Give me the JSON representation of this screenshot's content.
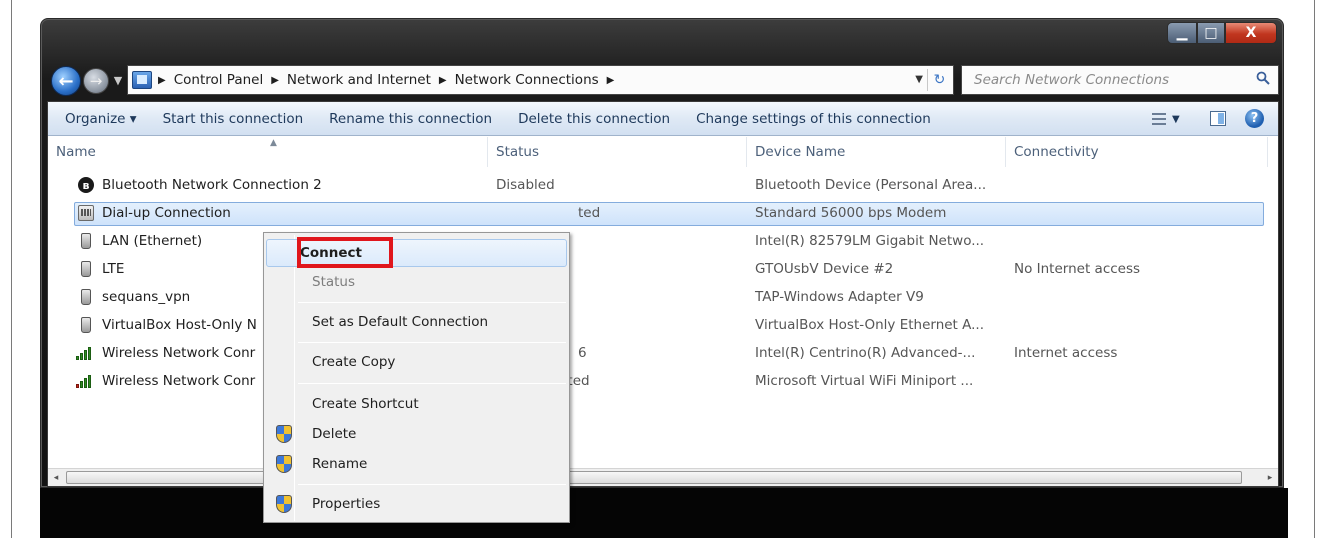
{
  "window": {
    "caption": {
      "minimize": "▁",
      "maximize": "□",
      "close": "X"
    }
  },
  "address_bar": {
    "crumbs": [
      "Control Panel",
      "Network and Internet",
      "Network Connections"
    ],
    "separator": "▶",
    "trailing_separator": "▶",
    "dropdown_glyph": "▼",
    "refresh_glyph": "↻"
  },
  "search": {
    "placeholder": "Search Network Connections"
  },
  "toolbar": {
    "organize": "Organize ▾",
    "start": "Start this connection",
    "rename": "Rename this connection",
    "delete": "Delete this connection",
    "change": "Change settings of this connection",
    "views_drop": "▼",
    "help": "?"
  },
  "columns": {
    "name": "Name",
    "status": "Status",
    "device": "Device Name",
    "connectivity": "Connectivity"
  },
  "rows": [
    {
      "name": "Bluetooth Network Connection 2",
      "status": "Disabled",
      "device": "Bluetooth Device (Personal Area...",
      "connectivity": "",
      "icon": "bluetooth-icon"
    },
    {
      "name": "Dial-up Connection",
      "status": "ted",
      "device": "Standard 56000 bps Modem",
      "connectivity": "",
      "icon": "modem-icon",
      "selected": true
    },
    {
      "name": "LAN (Ethernet)",
      "status": "",
      "device": "Intel(R) 82579LM Gigabit Netwo...",
      "connectivity": "",
      "icon": "network-plug-icon"
    },
    {
      "name": "LTE",
      "status": "",
      "device": "GTOUsbV Device #2",
      "connectivity": "No Internet access",
      "icon": "network-plug-icon"
    },
    {
      "name": "sequans_vpn",
      "status": "",
      "device": "TAP-Windows Adapter V9",
      "connectivity": "",
      "icon": "network-plug-icon"
    },
    {
      "name": "VirtualBox Host-Only N",
      "status": "",
      "device": "VirtualBox Host-Only Ethernet A...",
      "connectivity": "",
      "icon": "network-plug-icon"
    },
    {
      "name": "Wireless Network Conr",
      "status": "6",
      "device": "Intel(R) Centrino(R) Advanced-...",
      "connectivity": "Internet access",
      "icon": "wifi-signal-icon"
    },
    {
      "name": "Wireless Network Conr",
      "status": "cted",
      "device": "Microsoft Virtual WiFi Miniport ...",
      "connectivity": "",
      "icon": "wifi-signal-disconnected-icon"
    }
  ],
  "context_menu": {
    "connect": "Connect",
    "status": "Status",
    "set_default": "Set as Default Connection",
    "create_copy": "Create Copy",
    "create_shortcut": "Create Shortcut",
    "delete": "Delete",
    "rename": "Rename",
    "properties": "Properties"
  },
  "scrollbar": {
    "left": "◂",
    "right": "▸"
  },
  "colors": {
    "highlight_box": "#e0161c",
    "selection_border": "#84acdd",
    "command_bar_text": "#1e395b"
  }
}
